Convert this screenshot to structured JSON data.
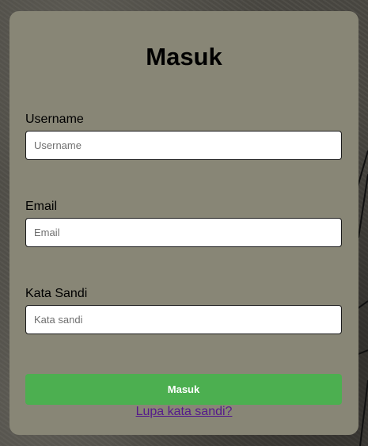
{
  "form": {
    "title": "Masuk",
    "fields": [
      {
        "label": "Username",
        "placeholder": "Username",
        "value": ""
      },
      {
        "label": "Email",
        "placeholder": "Email",
        "value": ""
      },
      {
        "label": "Kata Sandi",
        "placeholder": "Kata sandi",
        "value": ""
      }
    ],
    "submit_label": "Masuk",
    "forgot_link": "Lupa kata sandi?"
  },
  "colors": {
    "card": "#888676",
    "button": "#4caf50",
    "link": "#551a8b"
  }
}
